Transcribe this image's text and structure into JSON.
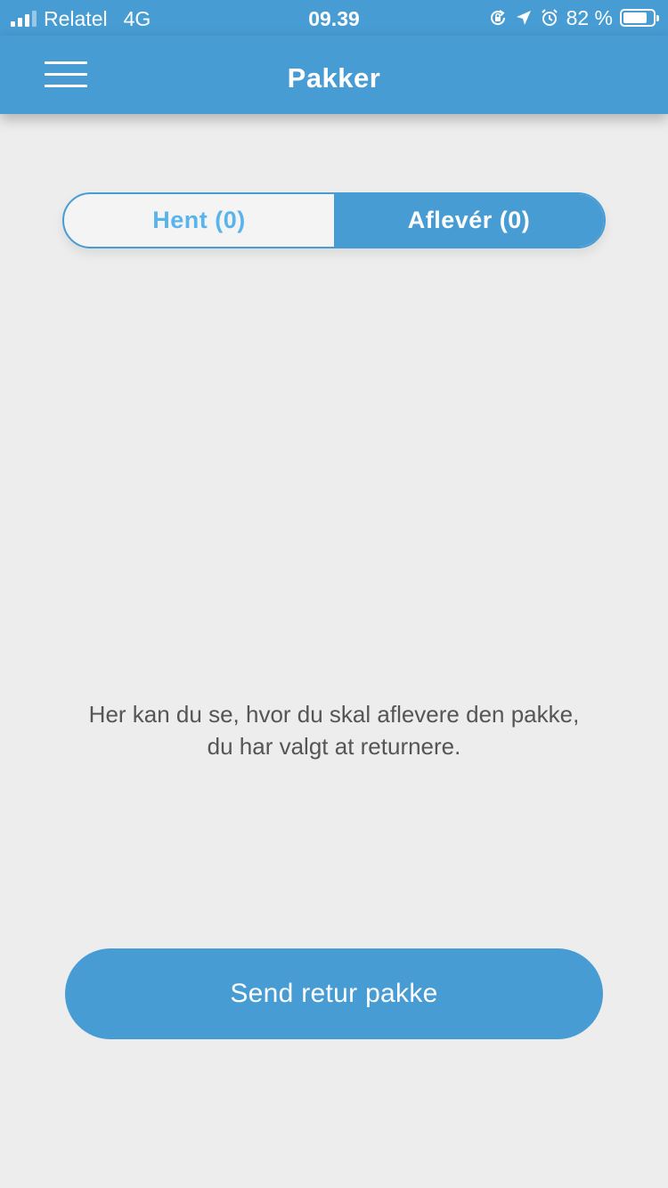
{
  "status_bar": {
    "carrier": "Relatel",
    "network": "4G",
    "time": "09.39",
    "battery_text": "82 %",
    "battery_level": 0.82,
    "icons": [
      "signal-icon",
      "orientation-lock-icon",
      "location-arrow-icon",
      "alarm-icon",
      "battery-icon"
    ]
  },
  "header": {
    "title": "Pakker",
    "menu_icon": "hamburger-menu-icon",
    "background_color": "#469cd3"
  },
  "tabs": [
    {
      "label": "Hent (0)",
      "selected": false
    },
    {
      "label": "Aflevér (0)",
      "selected": true
    }
  ],
  "empty_state": {
    "message": "Her kan du se, hvor du skal aflevere den pakke, du har valgt at returnere."
  },
  "actions": {
    "send_return_label": "Send retur pakke"
  },
  "colors": {
    "accent": "#469cd3",
    "inactive_tab_text": "#5ab4ec",
    "background": "#ededed"
  }
}
